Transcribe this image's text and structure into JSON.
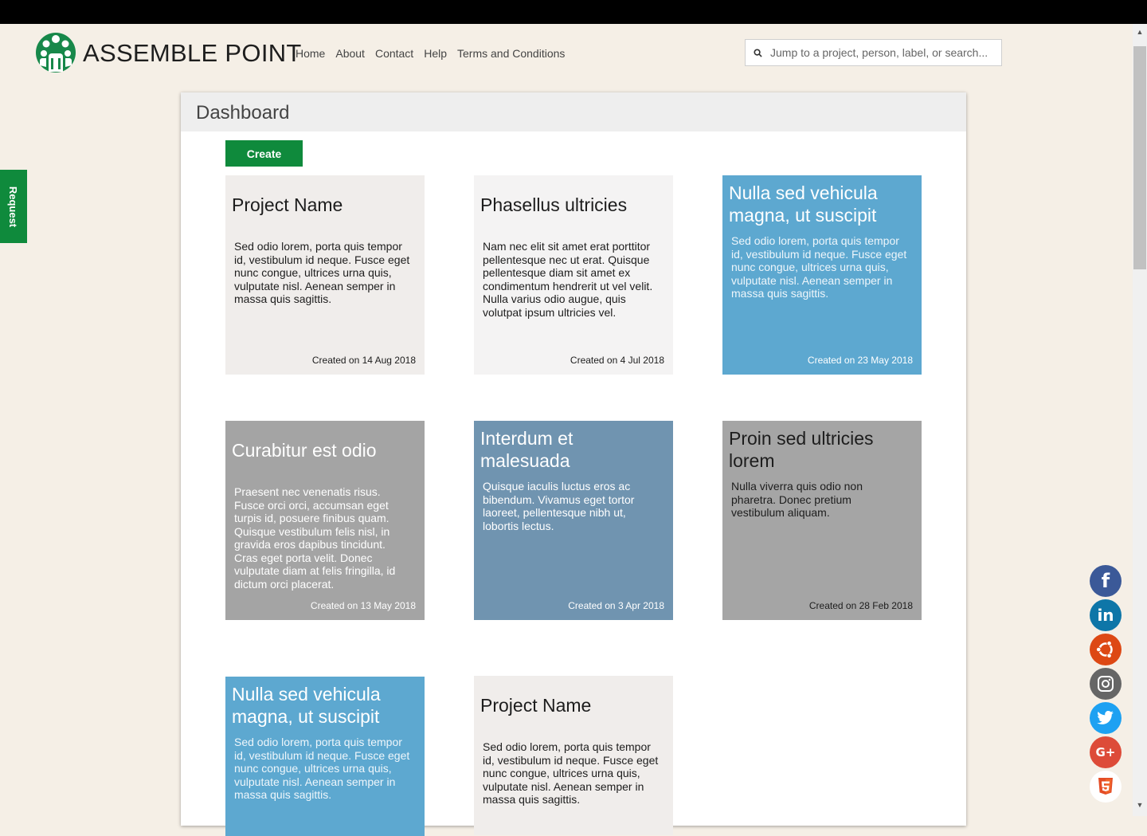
{
  "header": {
    "brand": "ASSEMBLE POINT",
    "nav": [
      "Home",
      "About",
      "Contact",
      "Help",
      "Terms and Conditions"
    ],
    "search_placeholder": "Jump to a project, person, label, or search..."
  },
  "request_tab": "Request",
  "dashboard": {
    "title": "Dashboard",
    "create_label": "Create",
    "cards": [
      {
        "title": "Project Name",
        "desc": "Sed odio lorem, porta quis tempor id, vestibulum id neque. Fusce eget nunc congue, ultrices urna quis, vulputate nisl. Aenean semper in massa quis sagittis.",
        "date": "Created on 14 Aug 2018"
      },
      {
        "title": "Phasellus ultricies",
        "desc": "Nam nec elit sit amet erat porttitor pellentesque nec ut erat. Quisque pellentesque diam sit amet ex condimentum hendrerit ut vel velit. Nulla varius odio augue, quis volutpat ipsum ultricies vel.",
        "date": "Created on 4 Jul 2018"
      },
      {
        "title": "Nulla sed vehicula magna, ut suscipit",
        "desc": "Sed odio lorem, porta quis tempor id, vestibulum id neque. Fusce eget nunc congue, ultrices urna quis, vulputate nisl. Aenean semper in massa quis sagittis.",
        "date": "Created on 23 May 2018"
      },
      {
        "title": "Curabitur est odio",
        "desc": "Praesent nec venenatis risus. Fusce orci orci, accumsan eget turpis id, posuere finibus quam. Quisque vestibulum felis nisl, in gravida eros dapibus tincidunt. Cras eget porta velit. Donec vulputate diam at felis fringilla, id dictum orci placerat.",
        "date": "Created on 13 May 2018"
      },
      {
        "title": "Interdum et malesuada",
        "desc": "Quisque iaculis luctus eros ac bibendum. Vivamus eget tortor laoreet, pellentesque nibh ut, lobortis lectus.",
        "date": "Created on 3 Apr 2018"
      },
      {
        "title": "Proin sed ultricies lorem",
        "desc": "Nulla viverra quis odio non pharetra. Donec pretium vestibulum aliquam.",
        "date": "Created on 28 Feb 2018"
      },
      {
        "title": "Nulla sed vehicula magna, ut suscipit",
        "desc": "Sed odio lorem, porta quis tempor id, vestibulum id neque. Fusce eget nunc congue, ultrices urna quis, vulputate nisl. Aenean semper in massa quis sagittis.",
        "date": ""
      },
      {
        "title": "Project Name",
        "desc": "Sed odio lorem, porta quis tempor id, vestibulum id neque. Fusce eget nunc congue, ultrices urna quis, vulputate nisl. Aenean semper in massa quis sagittis.",
        "date": ""
      }
    ]
  },
  "social": [
    {
      "name": "facebook-icon",
      "glyph": "f",
      "color": "#3b5998"
    },
    {
      "name": "linkedin-icon",
      "glyph": "in",
      "color": "#0e76a8"
    },
    {
      "name": "ubuntu-icon",
      "glyph": "◉",
      "color": "#dd4814"
    },
    {
      "name": "instagram-icon",
      "glyph": "◎",
      "color": "#666666"
    },
    {
      "name": "twitter-icon",
      "glyph": "🐦",
      "color": "#1da1f2"
    },
    {
      "name": "google-plus-icon",
      "glyph": "G+",
      "color": "#dd4b39"
    },
    {
      "name": "html5-icon",
      "glyph": "5",
      "color": "#e44d26"
    }
  ],
  "colors": {
    "brand_green": "#0f8a3c",
    "card_blue": "#5da8d0",
    "card_slate": "#7094b0",
    "card_gray": "#a4a4a4",
    "card_light": "#f0edeb"
  }
}
